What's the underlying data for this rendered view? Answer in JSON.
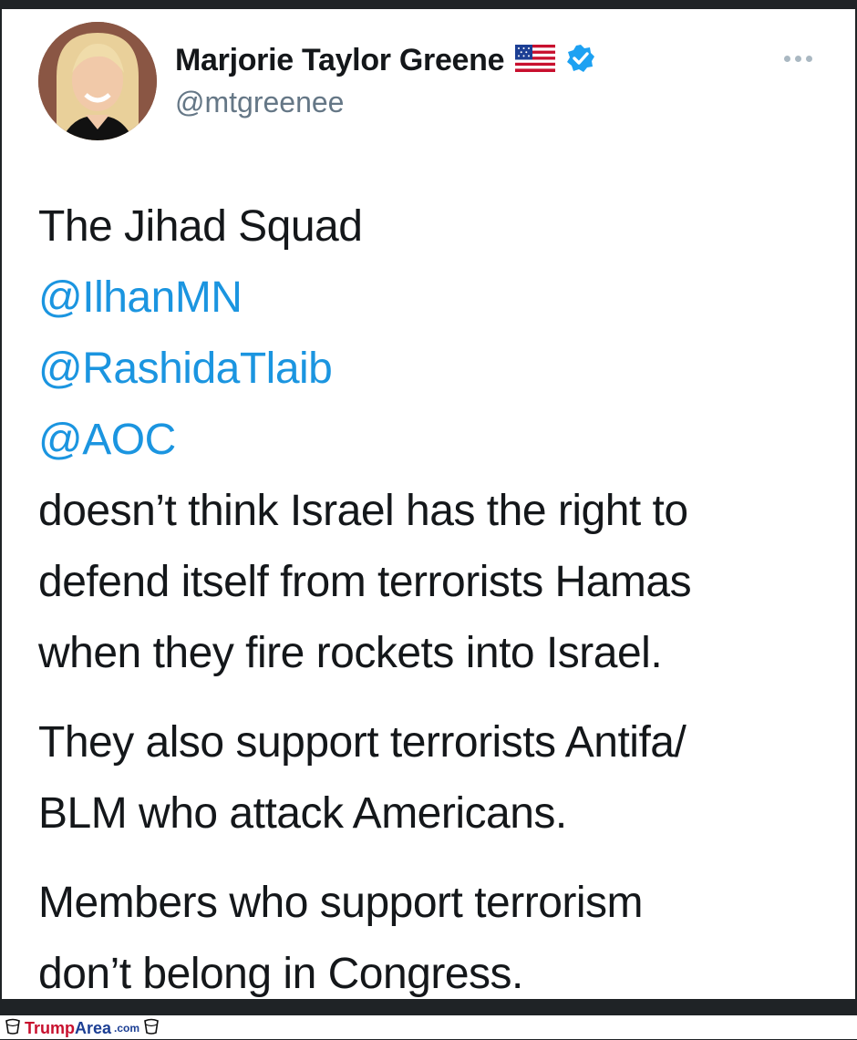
{
  "tweet": {
    "display_name": "Marjorie Taylor Greene",
    "handle": "@mtgreenee",
    "flag_icon": "us-flag-icon",
    "verified_icon": "verified-badge-icon",
    "more_icon": "more-options-icon",
    "lines": {
      "l1": "The Jihad Squad",
      "m1": "@IlhanMN",
      "m2": "@RashidaTlaib",
      "m3": "@AOC",
      "p1a": "doesn’t think Israel has the right to",
      "p1b": "defend itself from terrorists Hamas",
      "p1c": "when they fire rockets into Israel.",
      "p2a": "They also support terrorists Antifa/",
      "p2b": "BLM who attack Americans.",
      "p3a": "Members who support terrorism",
      "p3b": "don’t belong in Congress."
    },
    "colors": {
      "mention": "#1b95e0",
      "verified": "#1da1f2",
      "text": "#14171a",
      "handle": "#657786"
    }
  },
  "watermark": {
    "part1": "Trump",
    "part2": "Area",
    "suffix": ".com"
  }
}
